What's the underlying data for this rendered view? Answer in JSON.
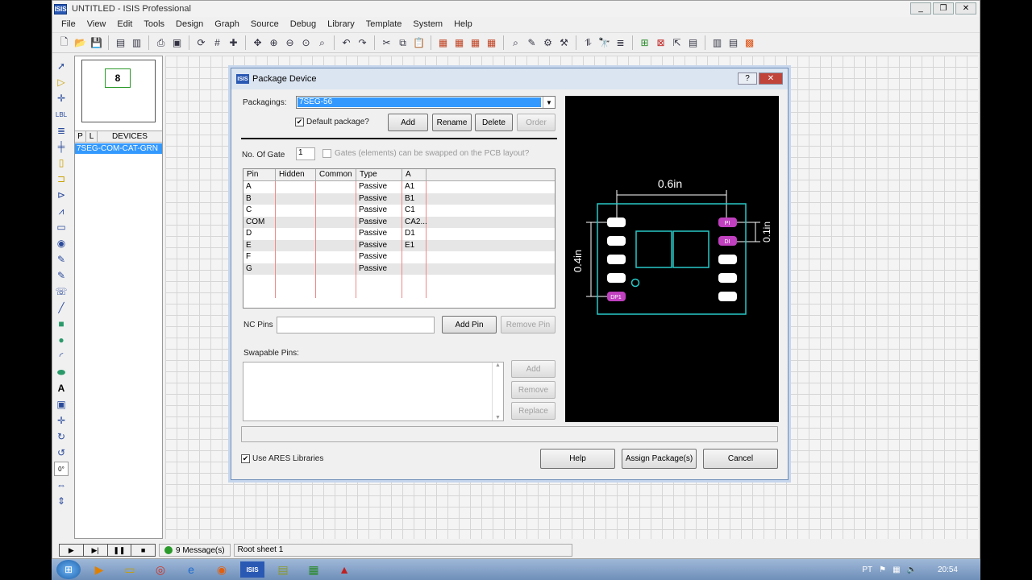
{
  "app": {
    "title": "UNTITLED - ISIS Professional",
    "icon_label": "ISIS",
    "window_controls": [
      "_",
      "❐",
      "✕"
    ]
  },
  "menu": [
    "File",
    "View",
    "Edit",
    "Tools",
    "Design",
    "Graph",
    "Source",
    "Debug",
    "Library",
    "Template",
    "System",
    "Help"
  ],
  "left_panel": {
    "preview_chip": "8",
    "tabs": [
      "P",
      "L"
    ],
    "devices_header": "DEVICES",
    "devices": [
      "7SEG-COM-CAT-GRN"
    ]
  },
  "status": {
    "messages": "9 Message(s)",
    "sheet": "Root sheet 1"
  },
  "dialog": {
    "title": "Package Device",
    "icon_label": "ISIS",
    "help_ctl": "?",
    "close_ctl": "✕",
    "packagings_label": "Packagings:",
    "packaging_value": "7SEG-56",
    "default_package_label": "Default package?",
    "default_package_checked": true,
    "buttons": {
      "add": "Add",
      "rename": "Rename",
      "delete": "Delete",
      "order": "Order",
      "add_pin": "Add Pin",
      "remove_pin": "Remove Pin",
      "swap_add": "Add",
      "swap_remove": "Remove",
      "swap_replace": "Replace",
      "help": "Help",
      "assign": "Assign Package(s)",
      "cancel": "Cancel"
    },
    "gate_label": "No. Of Gate",
    "gate_value": "1",
    "gates_swap_label": "Gates (elements) can be swapped on the PCB layout?",
    "grid": {
      "headers": [
        "Pin",
        "Hidden",
        "Common",
        "Type",
        "A"
      ],
      "rows": [
        [
          "A",
          "",
          "",
          "Passive",
          "A1"
        ],
        [
          "B",
          "",
          "",
          "Passive",
          "B1"
        ],
        [
          "C",
          "",
          "",
          "Passive",
          "C1"
        ],
        [
          "COM",
          "",
          "",
          "Passive",
          "CA2..."
        ],
        [
          "D",
          "",
          "",
          "Passive",
          "D1"
        ],
        [
          "E",
          "",
          "",
          "Passive",
          "E1"
        ],
        [
          "F",
          "",
          "",
          "Passive",
          ""
        ],
        [
          "G",
          "",
          "",
          "Passive",
          ""
        ]
      ]
    },
    "nc_pins_label": "NC Pins",
    "swapable_label": "Swapable Pins:",
    "use_ares_label": "Use ARES Libraries",
    "use_ares_checked": true,
    "footprint": {
      "width_label": "0.6in",
      "height_label": "0.4in",
      "pitch_label": "0.1in",
      "pad_labels": [
        "PI",
        "DI",
        "DP1"
      ],
      "outline_color": "#28c8c8",
      "pad_color": "#ffffff",
      "highlight_pad_color": "#c040c0"
    }
  },
  "taskbar": {
    "lang": "PT",
    "time": "20:54"
  }
}
